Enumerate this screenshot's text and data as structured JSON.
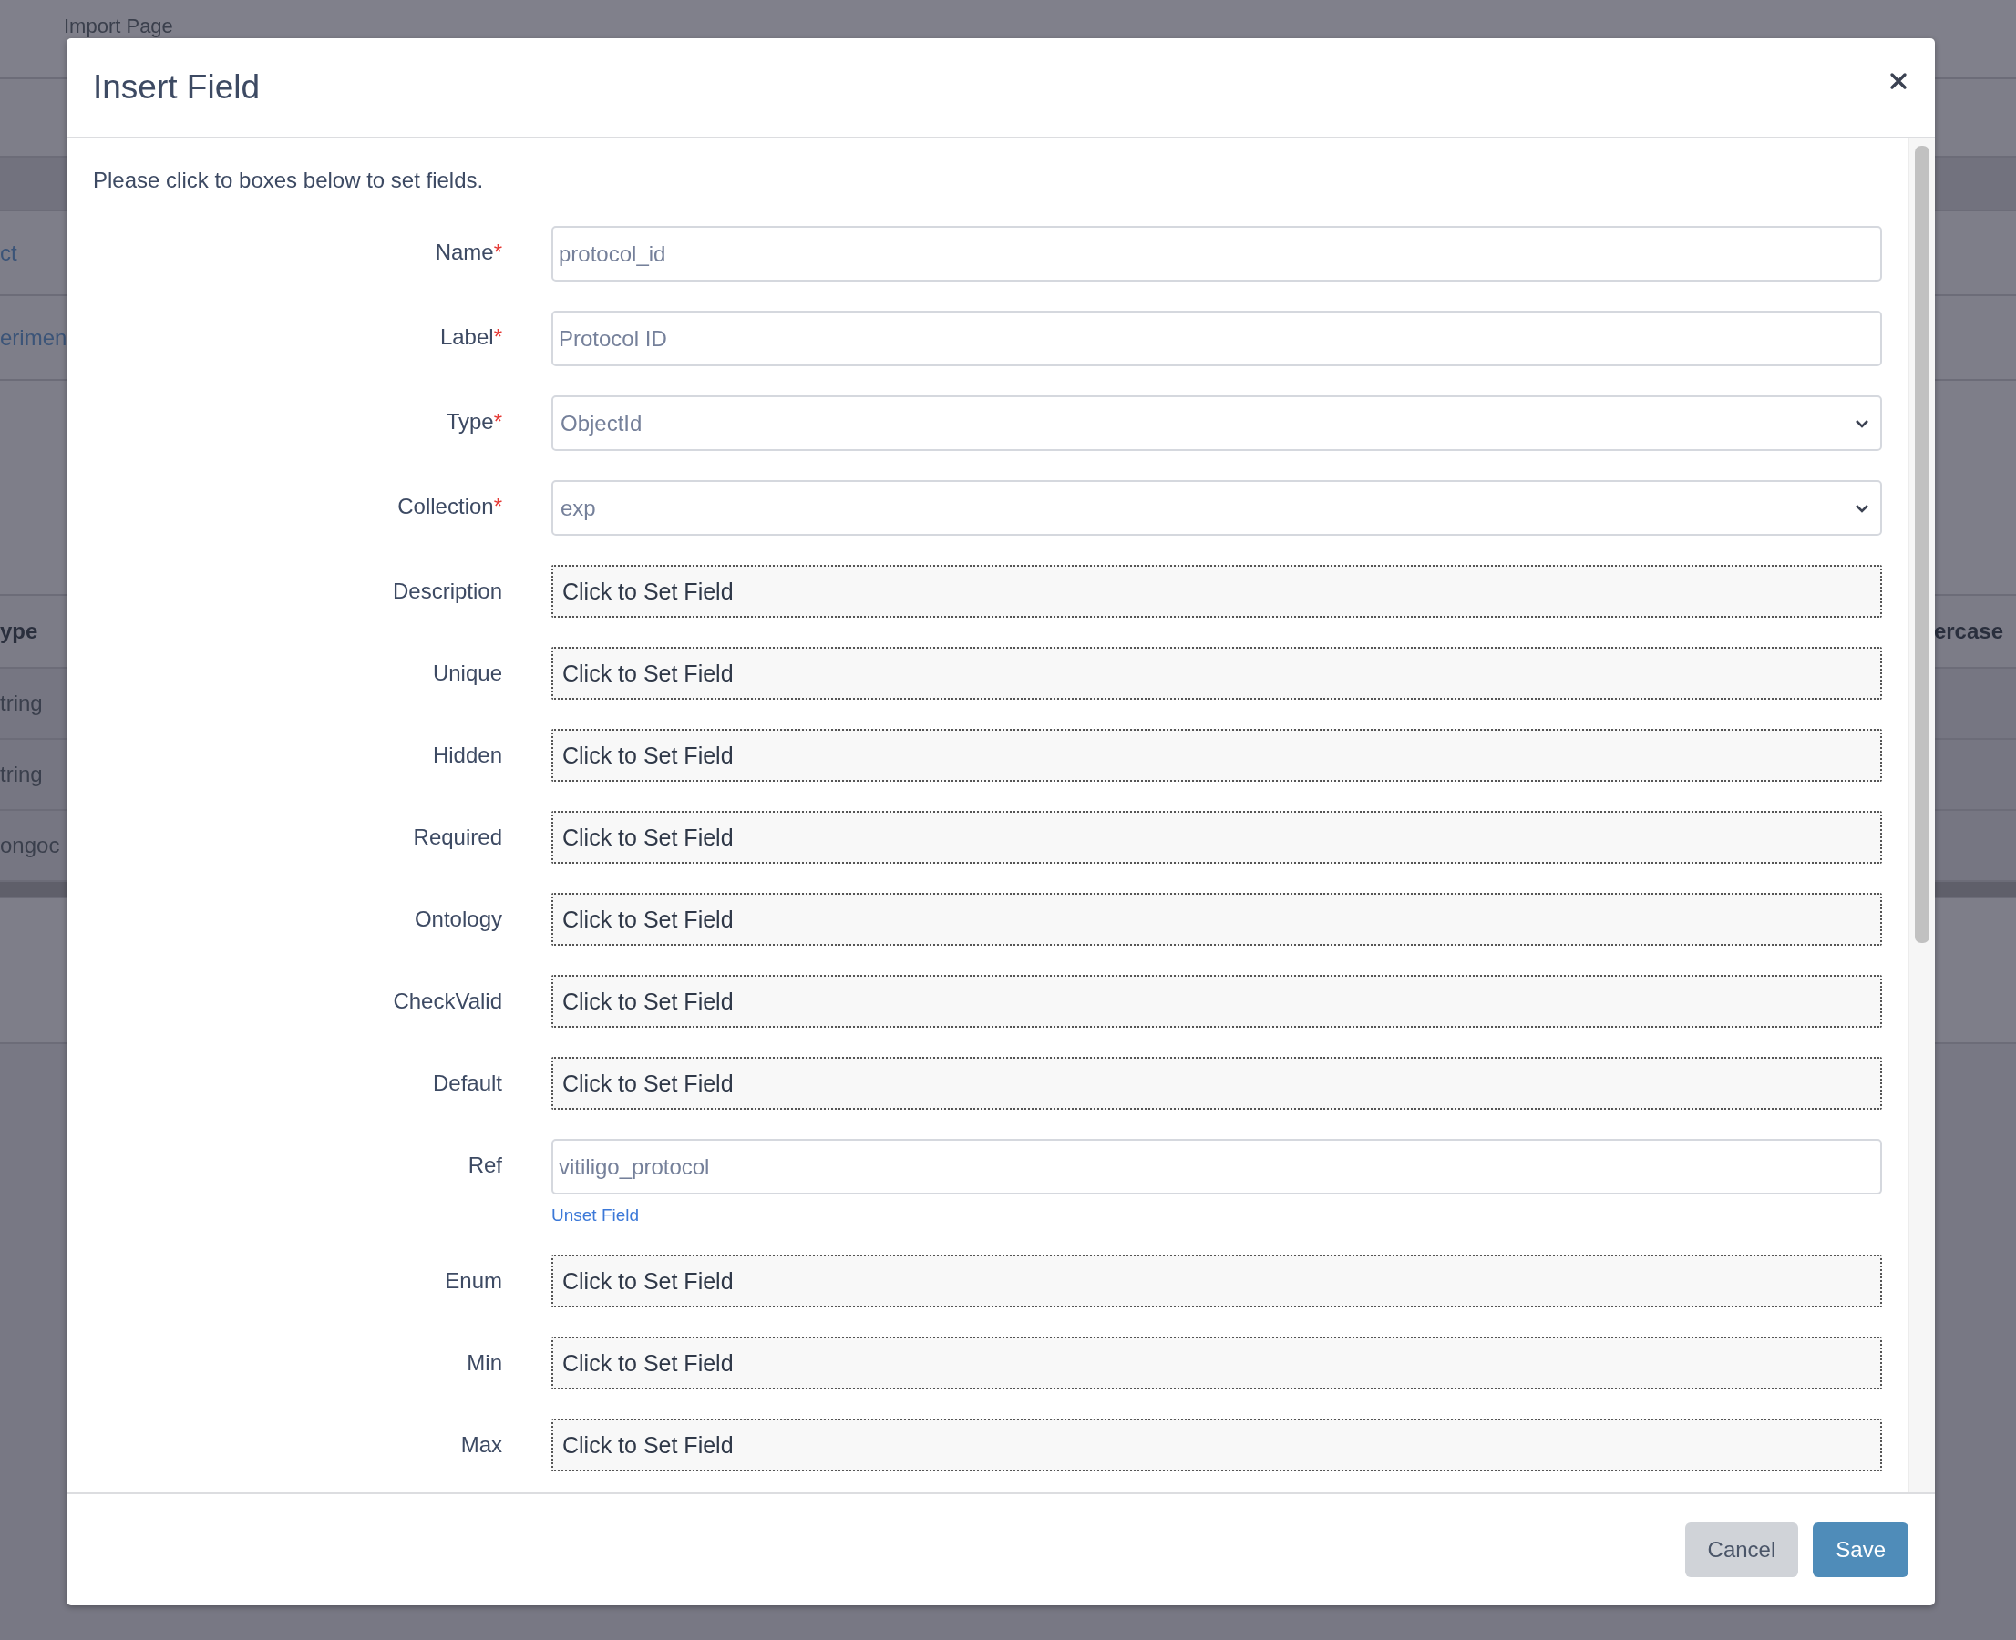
{
  "background": {
    "page_title": "Import Page",
    "links": [
      "ct",
      "erimen"
    ],
    "table": {
      "headers": [
        "ype",
        "ercase"
      ],
      "cells": [
        "tring",
        "tring",
        "ongoc"
      ]
    }
  },
  "dialog": {
    "title": "Insert Field",
    "intro": "Please click to boxes below to set fields.",
    "fields": [
      {
        "label": "Name",
        "required_mark": "*",
        "kind": "text",
        "value": "protocol_id"
      },
      {
        "label": "Label",
        "required_mark": "*",
        "kind": "text",
        "value": "Protocol ID"
      },
      {
        "label": "Type",
        "required_mark": "*",
        "kind": "select",
        "value": "ObjectId"
      },
      {
        "label": "Collection",
        "required_mark": "*",
        "kind": "select",
        "value": "exp"
      },
      {
        "label": "Description",
        "kind": "unset",
        "value": "Click to Set Field"
      },
      {
        "label": "Unique",
        "kind": "unset",
        "value": "Click to Set Field"
      },
      {
        "label": "Hidden",
        "kind": "unset",
        "value": "Click to Set Field"
      },
      {
        "label": "Required",
        "kind": "unset",
        "value": "Click to Set Field"
      },
      {
        "label": "Ontology",
        "kind": "unset",
        "value": "Click to Set Field"
      },
      {
        "label": "CheckValid",
        "kind": "unset",
        "value": "Click to Set Field"
      },
      {
        "label": "Default",
        "kind": "unset",
        "value": "Click to Set Field"
      },
      {
        "label": "Ref",
        "kind": "text",
        "value": "vitiligo_protocol",
        "link": "Unset Field"
      },
      {
        "label": "Enum",
        "kind": "unset",
        "value": "Click to Set Field"
      },
      {
        "label": "Min",
        "kind": "unset",
        "value": "Click to Set Field"
      },
      {
        "label": "Max",
        "kind": "unset",
        "value": "Click to Set Field"
      }
    ],
    "buttons": [
      {
        "label": "Cancel",
        "kind": "secondary"
      },
      {
        "label": "Save",
        "kind": "primary"
      }
    ]
  }
}
